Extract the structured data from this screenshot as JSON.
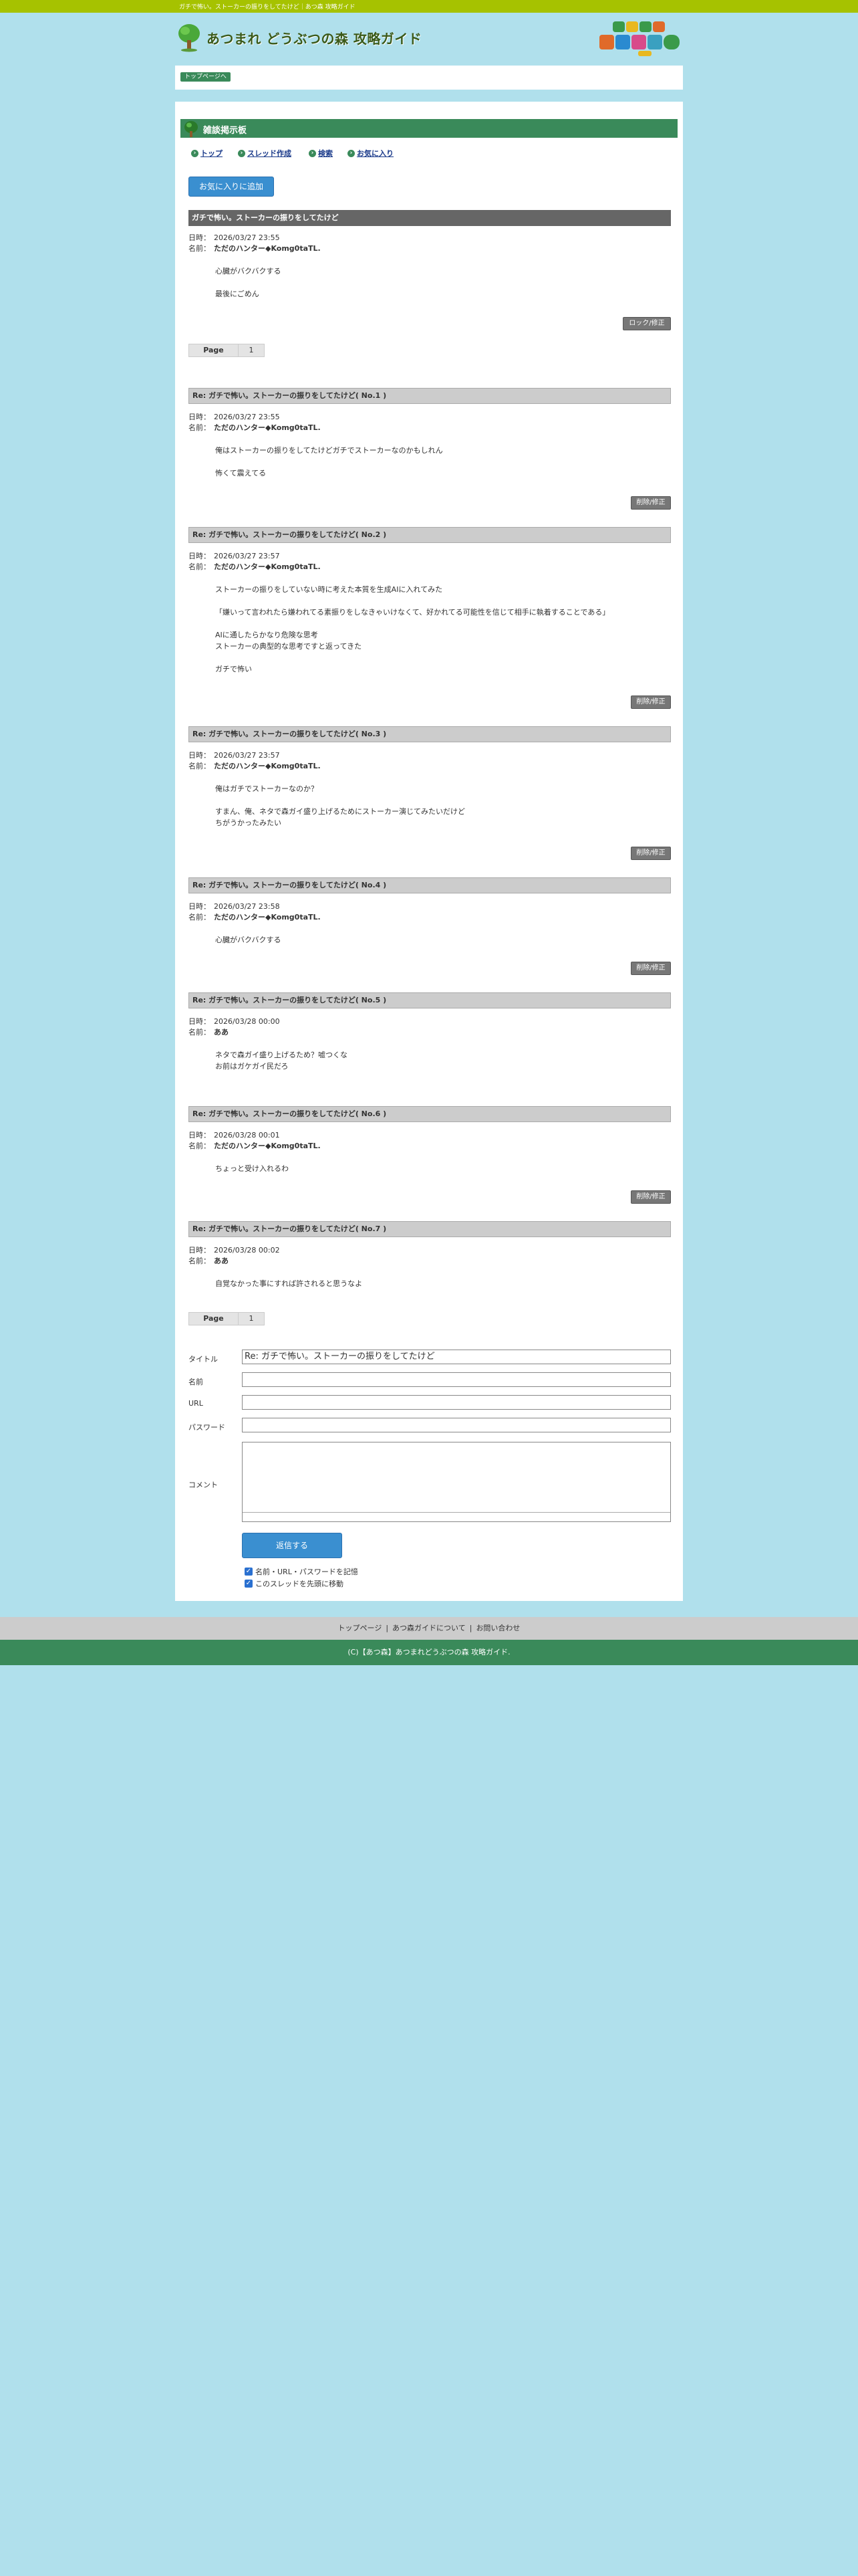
{
  "topbar": {
    "text": "ガチで怖い。ストーカーの振りをしてたけど｜あつ森 攻略ガイド"
  },
  "header": {
    "site_title": "あつまれ どうぶつの森 攻略ガイド"
  },
  "breadcrumb": {
    "label": "トップページへ"
  },
  "section": {
    "title": "雑談掲示板"
  },
  "nav": {
    "items": [
      "トップ",
      "スレッド作成",
      "検索",
      "お気に入り"
    ]
  },
  "fav_button": "お気に入りに追加",
  "labels": {
    "date": "日時：",
    "name": "名前：",
    "lock_button": "ロック/修正",
    "delete_button": "削除/修正",
    "page": "Page",
    "page_num": "1"
  },
  "thread": {
    "title": "ガチで怖い。ストーカーの振りをしてたけど",
    "date": "2026/03/27 23:55",
    "name": "ただのハンター◆Komg0taTL.",
    "body": "心臓がバクバクする\n\n最後にごめん"
  },
  "replies": [
    {
      "title": "Re: ガチで怖い。ストーカーの振りをしてたけど( No.1 )",
      "date": "2026/03/27 23:55",
      "name": "ただのハンター◆Komg0taTL.",
      "body": "俺はストーカーの振りをしてたけどガチでストーカーなのかもしれん\n\n怖くて震えてる"
    },
    {
      "title": "Re: ガチで怖い。ストーカーの振りをしてたけど( No.2 )",
      "date": "2026/03/27 23:57",
      "name": "ただのハンター◆Komg0taTL.",
      "body": "ストーカーの振りをしていない時に考えた本質を生成AIに入れてみた\n\n「嫌いって言われたら嫌われてる素振りをしなきゃいけなくて、好かれてる可能性を信じて相手に執着することである」\n\nAIに通したらかなり危険な思考\nストーカーの典型的な思考ですと返ってきた\n\nガチで怖い"
    },
    {
      "title": "Re: ガチで怖い。ストーカーの振りをしてたけど( No.3 )",
      "date": "2026/03/27 23:57",
      "name": "ただのハンター◆Komg0taTL.",
      "body": "俺はガチでストーカーなのか？\n\nすまん、俺、ネタで森ガイ盛り上げるためにストーカー演じてみたいだけど\nちがうかったみたい"
    },
    {
      "title": "Re: ガチで怖い。ストーカーの振りをしてたけど( No.4 )",
      "date": "2026/03/27 23:58",
      "name": "ただのハンター◆Komg0taTL.",
      "body": "心臓がバクバクする"
    },
    {
      "title": "Re: ガチで怖い。ストーカーの振りをしてたけど( No.5 )",
      "date": "2026/03/28 00:00",
      "name": "ああ",
      "body": "ネタで森ガイ盛り上げるため？嘘つくな\nお前はガケガイ民だろ"
    },
    {
      "title": "Re: ガチで怖い。ストーカーの振りをしてたけど( No.6 )",
      "date": "2026/03/28 00:01",
      "name": "ただのハンター◆Komg0taTL.",
      "body": "ちょっと受け入れるわ"
    },
    {
      "title": "Re: ガチで怖い。ストーカーの振りをしてたけど( No.7 )",
      "date": "2026/03/28 00:02",
      "name": "ああ",
      "body": "自覚なかった事にすれば許されると思うなよ"
    }
  ],
  "form": {
    "title_label": "タイトル",
    "title_value": "Re: ガチで怖い。ストーカーの振りをしてたけど",
    "name_label": "名前",
    "url_label": "URL",
    "password_label": "パスワード",
    "comment_label": "コメント",
    "submit": "返信する",
    "remember": "名前・URL・パスワードを記憶",
    "move_top": "このスレッドを先頭に移動"
  },
  "footer": {
    "links": [
      "トップページ",
      "あつ森ガイドについて",
      "お問い合わせ"
    ],
    "copyright": "(C)【あつ森】あつまれどうぶつの森 攻略ガイド."
  }
}
